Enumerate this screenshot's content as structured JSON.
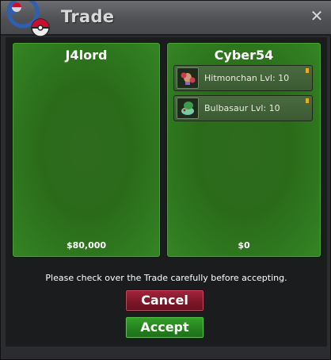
{
  "window": {
    "title": "Trade"
  },
  "left_panel": {
    "player": "J4lord",
    "money": "$80,000",
    "items": []
  },
  "right_panel": {
    "player": "Cyber54",
    "money": "$0",
    "items": [
      {
        "label": "Hitmonchan  Lvl: 10",
        "icon": "hitmonchan-sprite"
      },
      {
        "label": "Bulbasaur  Lvl: 10",
        "icon": "bulbasaur-sprite"
      }
    ]
  },
  "notice": "Please check over the Trade carefully before accepting.",
  "buttons": {
    "cancel": "Cancel",
    "accept": "Accept"
  },
  "colors": {
    "panel_green": "#2f6b1e",
    "cancel_red": "#7c1528",
    "accept_green": "#24801d"
  }
}
